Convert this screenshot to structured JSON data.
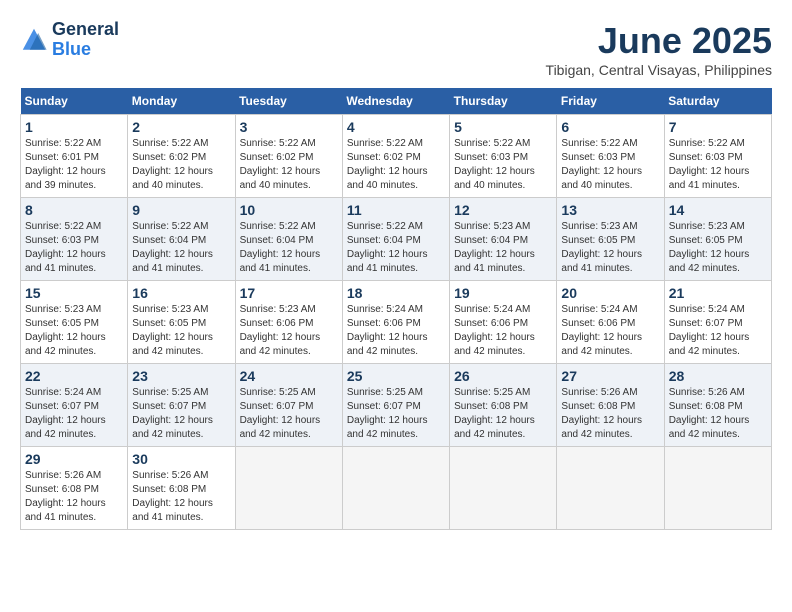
{
  "header": {
    "logo_line1": "General",
    "logo_line2": "Blue",
    "month_year": "June 2025",
    "location": "Tibigan, Central Visayas, Philippines"
  },
  "weekdays": [
    "Sunday",
    "Monday",
    "Tuesday",
    "Wednesday",
    "Thursday",
    "Friday",
    "Saturday"
  ],
  "days": [
    {
      "num": "",
      "sunrise": "",
      "sunset": "",
      "daylight": "",
      "empty": true
    },
    {
      "num": "2",
      "sunrise": "Sunrise: 5:22 AM",
      "sunset": "Sunset: 6:02 PM",
      "daylight": "Daylight: 12 hours and 40 minutes."
    },
    {
      "num": "3",
      "sunrise": "Sunrise: 5:22 AM",
      "sunset": "Sunset: 6:02 PM",
      "daylight": "Daylight: 12 hours and 40 minutes."
    },
    {
      "num": "4",
      "sunrise": "Sunrise: 5:22 AM",
      "sunset": "Sunset: 6:02 PM",
      "daylight": "Daylight: 12 hours and 40 minutes."
    },
    {
      "num": "5",
      "sunrise": "Sunrise: 5:22 AM",
      "sunset": "Sunset: 6:03 PM",
      "daylight": "Daylight: 12 hours and 40 minutes."
    },
    {
      "num": "6",
      "sunrise": "Sunrise: 5:22 AM",
      "sunset": "Sunset: 6:03 PM",
      "daylight": "Daylight: 12 hours and 40 minutes."
    },
    {
      "num": "7",
      "sunrise": "Sunrise: 5:22 AM",
      "sunset": "Sunset: 6:03 PM",
      "daylight": "Daylight: 12 hours and 41 minutes."
    },
    {
      "num": "8",
      "sunrise": "Sunrise: 5:22 AM",
      "sunset": "Sunset: 6:03 PM",
      "daylight": "Daylight: 12 hours and 41 minutes."
    },
    {
      "num": "9",
      "sunrise": "Sunrise: 5:22 AM",
      "sunset": "Sunset: 6:04 PM",
      "daylight": "Daylight: 12 hours and 41 minutes."
    },
    {
      "num": "10",
      "sunrise": "Sunrise: 5:22 AM",
      "sunset": "Sunset: 6:04 PM",
      "daylight": "Daylight: 12 hours and 41 minutes."
    },
    {
      "num": "11",
      "sunrise": "Sunrise: 5:22 AM",
      "sunset": "Sunset: 6:04 PM",
      "daylight": "Daylight: 12 hours and 41 minutes."
    },
    {
      "num": "12",
      "sunrise": "Sunrise: 5:23 AM",
      "sunset": "Sunset: 6:04 PM",
      "daylight": "Daylight: 12 hours and 41 minutes."
    },
    {
      "num": "13",
      "sunrise": "Sunrise: 5:23 AM",
      "sunset": "Sunset: 6:05 PM",
      "daylight": "Daylight: 12 hours and 41 minutes."
    },
    {
      "num": "14",
      "sunrise": "Sunrise: 5:23 AM",
      "sunset": "Sunset: 6:05 PM",
      "daylight": "Daylight: 12 hours and 42 minutes."
    },
    {
      "num": "15",
      "sunrise": "Sunrise: 5:23 AM",
      "sunset": "Sunset: 6:05 PM",
      "daylight": "Daylight: 12 hours and 42 minutes."
    },
    {
      "num": "16",
      "sunrise": "Sunrise: 5:23 AM",
      "sunset": "Sunset: 6:05 PM",
      "daylight": "Daylight: 12 hours and 42 minutes."
    },
    {
      "num": "17",
      "sunrise": "Sunrise: 5:23 AM",
      "sunset": "Sunset: 6:06 PM",
      "daylight": "Daylight: 12 hours and 42 minutes."
    },
    {
      "num": "18",
      "sunrise": "Sunrise: 5:24 AM",
      "sunset": "Sunset: 6:06 PM",
      "daylight": "Daylight: 12 hours and 42 minutes."
    },
    {
      "num": "19",
      "sunrise": "Sunrise: 5:24 AM",
      "sunset": "Sunset: 6:06 PM",
      "daylight": "Daylight: 12 hours and 42 minutes."
    },
    {
      "num": "20",
      "sunrise": "Sunrise: 5:24 AM",
      "sunset": "Sunset: 6:06 PM",
      "daylight": "Daylight: 12 hours and 42 minutes."
    },
    {
      "num": "21",
      "sunrise": "Sunrise: 5:24 AM",
      "sunset": "Sunset: 6:07 PM",
      "daylight": "Daylight: 12 hours and 42 minutes."
    },
    {
      "num": "22",
      "sunrise": "Sunrise: 5:24 AM",
      "sunset": "Sunset: 6:07 PM",
      "daylight": "Daylight: 12 hours and 42 minutes."
    },
    {
      "num": "23",
      "sunrise": "Sunrise: 5:25 AM",
      "sunset": "Sunset: 6:07 PM",
      "daylight": "Daylight: 12 hours and 42 minutes."
    },
    {
      "num": "24",
      "sunrise": "Sunrise: 5:25 AM",
      "sunset": "Sunset: 6:07 PM",
      "daylight": "Daylight: 12 hours and 42 minutes."
    },
    {
      "num": "25",
      "sunrise": "Sunrise: 5:25 AM",
      "sunset": "Sunset: 6:07 PM",
      "daylight": "Daylight: 12 hours and 42 minutes."
    },
    {
      "num": "26",
      "sunrise": "Sunrise: 5:25 AM",
      "sunset": "Sunset: 6:08 PM",
      "daylight": "Daylight: 12 hours and 42 minutes."
    },
    {
      "num": "27",
      "sunrise": "Sunrise: 5:26 AM",
      "sunset": "Sunset: 6:08 PM",
      "daylight": "Daylight: 12 hours and 42 minutes."
    },
    {
      "num": "28",
      "sunrise": "Sunrise: 5:26 AM",
      "sunset": "Sunset: 6:08 PM",
      "daylight": "Daylight: 12 hours and 42 minutes."
    },
    {
      "num": "29",
      "sunrise": "Sunrise: 5:26 AM",
      "sunset": "Sunset: 6:08 PM",
      "daylight": "Daylight: 12 hours and 41 minutes."
    },
    {
      "num": "30",
      "sunrise": "Sunrise: 5:26 AM",
      "sunset": "Sunset: 6:08 PM",
      "daylight": "Daylight: 12 hours and 41 minutes."
    },
    {
      "num": "",
      "sunrise": "",
      "sunset": "",
      "daylight": "",
      "empty": true
    },
    {
      "num": "",
      "sunrise": "",
      "sunset": "",
      "daylight": "",
      "empty": true
    },
    {
      "num": "",
      "sunrise": "",
      "sunset": "",
      "daylight": "",
      "empty": true
    },
    {
      "num": "",
      "sunrise": "",
      "sunset": "",
      "daylight": "",
      "empty": true
    },
    {
      "num": "",
      "sunrise": "",
      "sunset": "",
      "daylight": "",
      "empty": true
    }
  ],
  "day1": {
    "num": "1",
    "sunrise": "Sunrise: 5:22 AM",
    "sunset": "Sunset: 6:01 PM",
    "daylight": "Daylight: 12 hours and 39 minutes."
  }
}
